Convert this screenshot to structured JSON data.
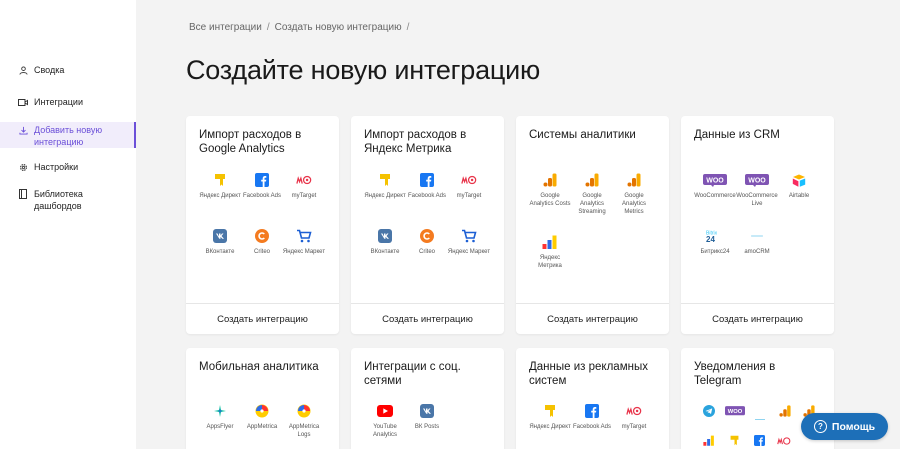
{
  "sidebar": {
    "items": [
      {
        "label": "Сводка",
        "icon": "user-icon"
      },
      {
        "label": "Интеграции",
        "icon": "video-icon"
      },
      {
        "label": "Добавить новую интеграцию",
        "icon": "download-icon"
      },
      {
        "label": "Настройки",
        "icon": "gear-icon"
      },
      {
        "label": "Библиотека дашбордов",
        "icon": "book-icon"
      }
    ]
  },
  "breadcrumb": {
    "items": [
      "Все интеграции",
      "Создать новую интеграцию"
    ],
    "separator": "/"
  },
  "page": {
    "title": "Создайте новую интеграцию"
  },
  "cards": [
    {
      "title": "Импорт расходов в Google Analytics",
      "button": "Создать интеграцию",
      "services": [
        "Яндекс Директ",
        "Facebook Ads",
        "myTarget",
        "ВКонтакте",
        "Criteo",
        "Яндекс Маркет"
      ]
    },
    {
      "title": "Импорт расходов в Яндекс Метрика",
      "button": "Создать интеграцию",
      "services": [
        "Яндекс Директ",
        "Facebook Ads",
        "myTarget",
        "ВКонтакте",
        "Criteo",
        "Яндекс Маркет"
      ]
    },
    {
      "title": "Системы аналитики",
      "button": "Создать интеграцию",
      "services": [
        "Google Analytics Costs",
        "Google Analytics Streaming",
        "Google Analytics Metrics",
        "Яндекс Метрика"
      ]
    },
    {
      "title": "Данные из CRM",
      "button": "Создать интеграцию",
      "services": [
        "WooCommerce",
        "WooCommerce Live",
        "Airtable",
        "Битрикс24",
        "amoCRM"
      ]
    },
    {
      "title": "Мобильная аналитика",
      "services": [
        "AppsFlyer",
        "AppMetrica",
        "AppMetrica Logs"
      ]
    },
    {
      "title": "Интеграции с соц. сетями",
      "services": [
        "YouTube Analytics",
        "ВК Posts"
      ]
    },
    {
      "title": "Данные из рекламных систем",
      "services": [
        "Яндекс Директ",
        "Facebook Ads",
        "myTarget"
      ]
    },
    {
      "title": "Уведомления в Telegram"
    }
  ],
  "help_button": {
    "label": "Помощь"
  },
  "colors": {
    "accent": "#6b4fd8",
    "help": "#1d6fb8",
    "yandex": "#fc3f1d",
    "facebook": "#1877f2",
    "vk": "#4a76a8",
    "woo": "#7f54b3"
  }
}
